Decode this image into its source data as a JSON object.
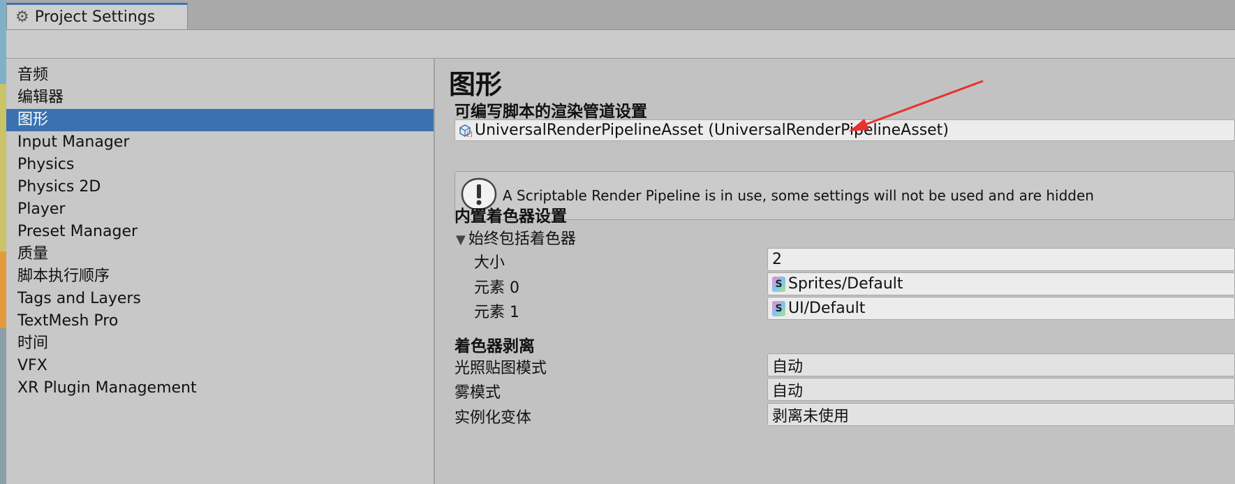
{
  "window": {
    "tab_title": "Project Settings",
    "tab_icon": "gear-icon"
  },
  "sidebar": {
    "items": [
      {
        "label": "音频"
      },
      {
        "label": "编辑器"
      },
      {
        "label": "图形",
        "selected": true
      },
      {
        "label": "Input Manager"
      },
      {
        "label": "Physics"
      },
      {
        "label": "Physics 2D"
      },
      {
        "label": "Player"
      },
      {
        "label": "Preset Manager"
      },
      {
        "label": "质量"
      },
      {
        "label": "脚本执行顺序"
      },
      {
        "label": "Tags and Layers"
      },
      {
        "label": "TextMesh Pro"
      },
      {
        "label": "时间"
      },
      {
        "label": "VFX"
      },
      {
        "label": "XR Plugin Management"
      }
    ],
    "selected_color": "#3a72b0"
  },
  "main": {
    "title": "图形",
    "srp_section": {
      "label": "可编写脚本的渲染管道设置",
      "asset_value": "UniversalRenderPipelineAsset (UniversalRenderPipelineAsset)"
    },
    "helpbox": {
      "icon": "warning-info-icon",
      "text": "A Scriptable Render Pipeline is in use, some settings will not be used and are hidden"
    },
    "builtin_shader_section": {
      "label": "内置着色器设置",
      "foldout_label": "始终包括着色器",
      "size_label": "大小",
      "size_value": "2",
      "elements": [
        {
          "label": "元素 0",
          "value": "Sprites/Default",
          "icon": "shader-icon"
        },
        {
          "label": "元素 1",
          "value": "UI/Default",
          "icon": "shader-icon"
        }
      ]
    },
    "shader_stripping_section": {
      "label": "着色器剥离",
      "rows": [
        {
          "label": "光照贴图模式",
          "value": "自动"
        },
        {
          "label": "雾模式",
          "value": "自动"
        },
        {
          "label": "实例化变体",
          "value": "剥离未使用"
        }
      ]
    }
  },
  "annotation": {
    "type": "red-arrow",
    "color": "#e8322a"
  }
}
